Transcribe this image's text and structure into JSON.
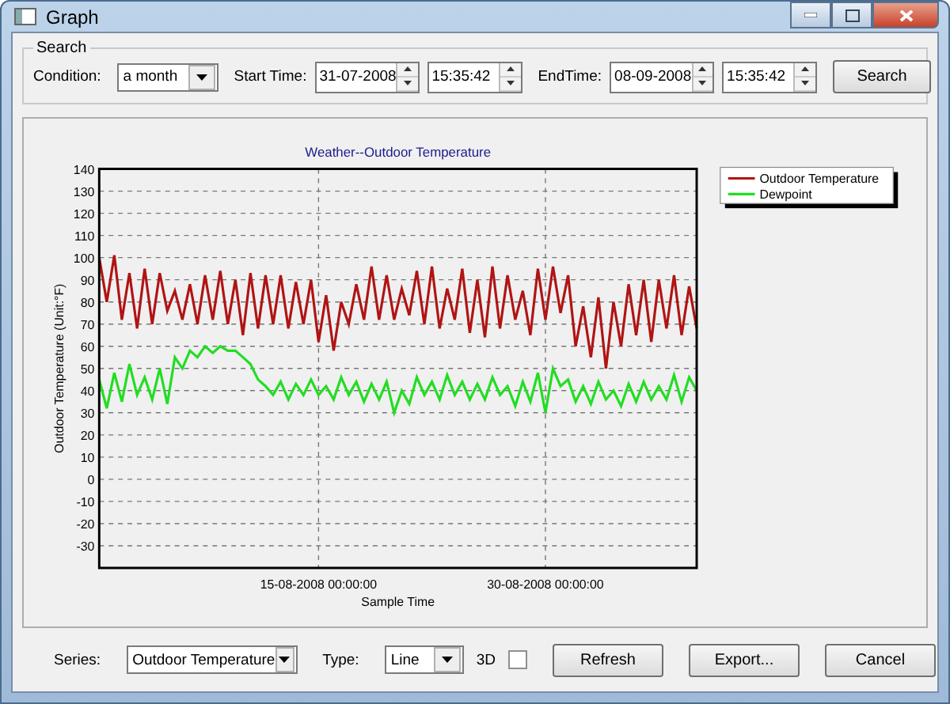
{
  "window": {
    "title": "Graph"
  },
  "search": {
    "legend": "Search",
    "condition": {
      "label": "Condition:",
      "value": "a month"
    },
    "start": {
      "label": "Start Time:",
      "date": "31-07-2008",
      "time": "15:35:42"
    },
    "end": {
      "label": "EndTime:",
      "date": "08-09-2008",
      "time": "15:35:42"
    },
    "button": "Search"
  },
  "chart": {
    "chart_data": {
      "type": "line",
      "title": "Weather--Outdoor Temperature",
      "xlabel": "Sample Time",
      "ylabel": "Outdoor Temperature (Unit:°F)",
      "categories": [
        null,
        null,
        null,
        null,
        null,
        null,
        null,
        null,
        null,
        null,
        null,
        null,
        null,
        null,
        null,
        null,
        null,
        null,
        null,
        null,
        null,
        null,
        null,
        null,
        null,
        null,
        null,
        null,
        null,
        "15-08-2008 00:00:00",
        null,
        null,
        null,
        null,
        null,
        null,
        null,
        null,
        null,
        null,
        null,
        null,
        null,
        null,
        null,
        null,
        null,
        null,
        null,
        null,
        null,
        null,
        null,
        null,
        null,
        null,
        null,
        null,
        null,
        "30-08-2008 00:00:00",
        null,
        null,
        null,
        null,
        null,
        null,
        null,
        null,
        null,
        null,
        null,
        null,
        null,
        null,
        null,
        null,
        null,
        null,
        null,
        null
      ],
      "series": [
        {
          "name": "Outdoor Temperature",
          "color": "#b01414",
          "values": [
            100,
            80,
            101,
            72,
            93,
            68,
            95,
            70,
            93,
            76,
            85,
            72,
            88,
            70,
            92,
            72,
            94,
            70,
            90,
            65,
            93,
            68,
            92,
            70,
            92,
            68,
            89,
            70,
            90,
            62,
            83,
            58,
            80,
            70,
            88,
            72,
            96,
            72,
            92,
            72,
            86,
            74,
            94,
            70,
            96,
            68,
            86,
            72,
            95,
            66,
            90,
            64,
            96,
            68,
            92,
            72,
            85,
            65,
            95,
            72,
            96,
            75,
            92,
            60,
            78,
            55,
            82,
            50,
            80,
            60,
            88,
            65,
            90,
            62,
            90,
            68,
            92,
            65,
            87,
            68
          ]
        },
        {
          "name": "Dewpoint",
          "color": "#22dd22",
          "values": [
            45,
            32,
            48,
            35,
            52,
            38,
            46,
            36,
            50,
            34,
            55,
            50,
            58,
            55,
            60,
            57,
            60,
            58,
            58,
            55,
            52,
            45,
            42,
            38,
            44,
            36,
            43,
            38,
            45,
            38,
            42,
            36,
            46,
            38,
            44,
            35,
            43,
            36,
            44,
            30,
            40,
            34,
            46,
            38,
            44,
            36,
            47,
            38,
            44,
            36,
            43,
            36,
            46,
            38,
            42,
            33,
            44,
            35,
            48,
            30,
            50,
            42,
            45,
            35,
            42,
            34,
            44,
            36,
            40,
            33,
            43,
            35,
            44,
            36,
            42,
            36,
            47,
            35,
            46,
            40
          ]
        }
      ],
      "grid": true,
      "legend": "right",
      "ylim": [
        -40,
        140
      ],
      "yticks": [
        -30,
        -20,
        -10,
        0,
        10,
        20,
        30,
        40,
        50,
        60,
        70,
        80,
        90,
        100,
        110,
        120,
        130,
        140
      ]
    }
  },
  "bottom": {
    "series": {
      "label": "Series:",
      "value": "Outdoor Temperature"
    },
    "type": {
      "label": "Type:",
      "value": "Line"
    },
    "three_d": {
      "label": "3D",
      "checked": false
    },
    "buttons": [
      "Refresh",
      "Export...",
      "Cancel"
    ]
  }
}
